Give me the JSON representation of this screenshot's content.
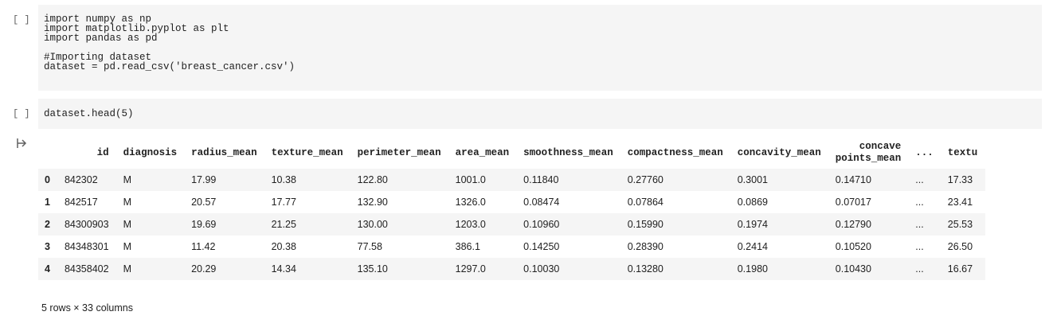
{
  "cells": [
    {
      "run_label": "[ ]",
      "code_lines": [
        "import numpy as np",
        "import matplotlib.pyplot as plt",
        "import pandas as pd",
        "",
        "#Importing dataset",
        "dataset = pd.read_csv('breast_cancer.csv')"
      ]
    },
    {
      "run_label": "[ ]",
      "code_lines": [
        "dataset.head(5)"
      ]
    }
  ],
  "output": {
    "icon": "output-arrow-icon",
    "columns": [
      "",
      "id",
      "diagnosis",
      "radius_mean",
      "texture_mean",
      "perimeter_mean",
      "area_mean",
      "smoothness_mean",
      "compactness_mean",
      "concavity_mean",
      "concave\npoints_mean",
      "...",
      "textu"
    ],
    "rows": [
      [
        "0",
        "842302",
        "M",
        "17.99",
        "10.38",
        "122.80",
        "1001.0",
        "0.11840",
        "0.27760",
        "0.3001",
        "0.14710",
        "...",
        "17.33"
      ],
      [
        "1",
        "842517",
        "M",
        "20.57",
        "17.77",
        "132.90",
        "1326.0",
        "0.08474",
        "0.07864",
        "0.0869",
        "0.07017",
        "...",
        "23.41"
      ],
      [
        "2",
        "84300903",
        "M",
        "19.69",
        "21.25",
        "130.00",
        "1203.0",
        "0.10960",
        "0.15990",
        "0.1974",
        "0.12790",
        "...",
        "25.53"
      ],
      [
        "3",
        "84348301",
        "M",
        "11.42",
        "20.38",
        "77.58",
        "386.1",
        "0.14250",
        "0.28390",
        "0.2414",
        "0.10520",
        "...",
        "26.50"
      ],
      [
        "4",
        "84358402",
        "M",
        "20.29",
        "14.34",
        "135.10",
        "1297.0",
        "0.10030",
        "0.13280",
        "0.1980",
        "0.10430",
        "...",
        "16.67"
      ]
    ],
    "footer": "5 rows × 33 columns"
  }
}
